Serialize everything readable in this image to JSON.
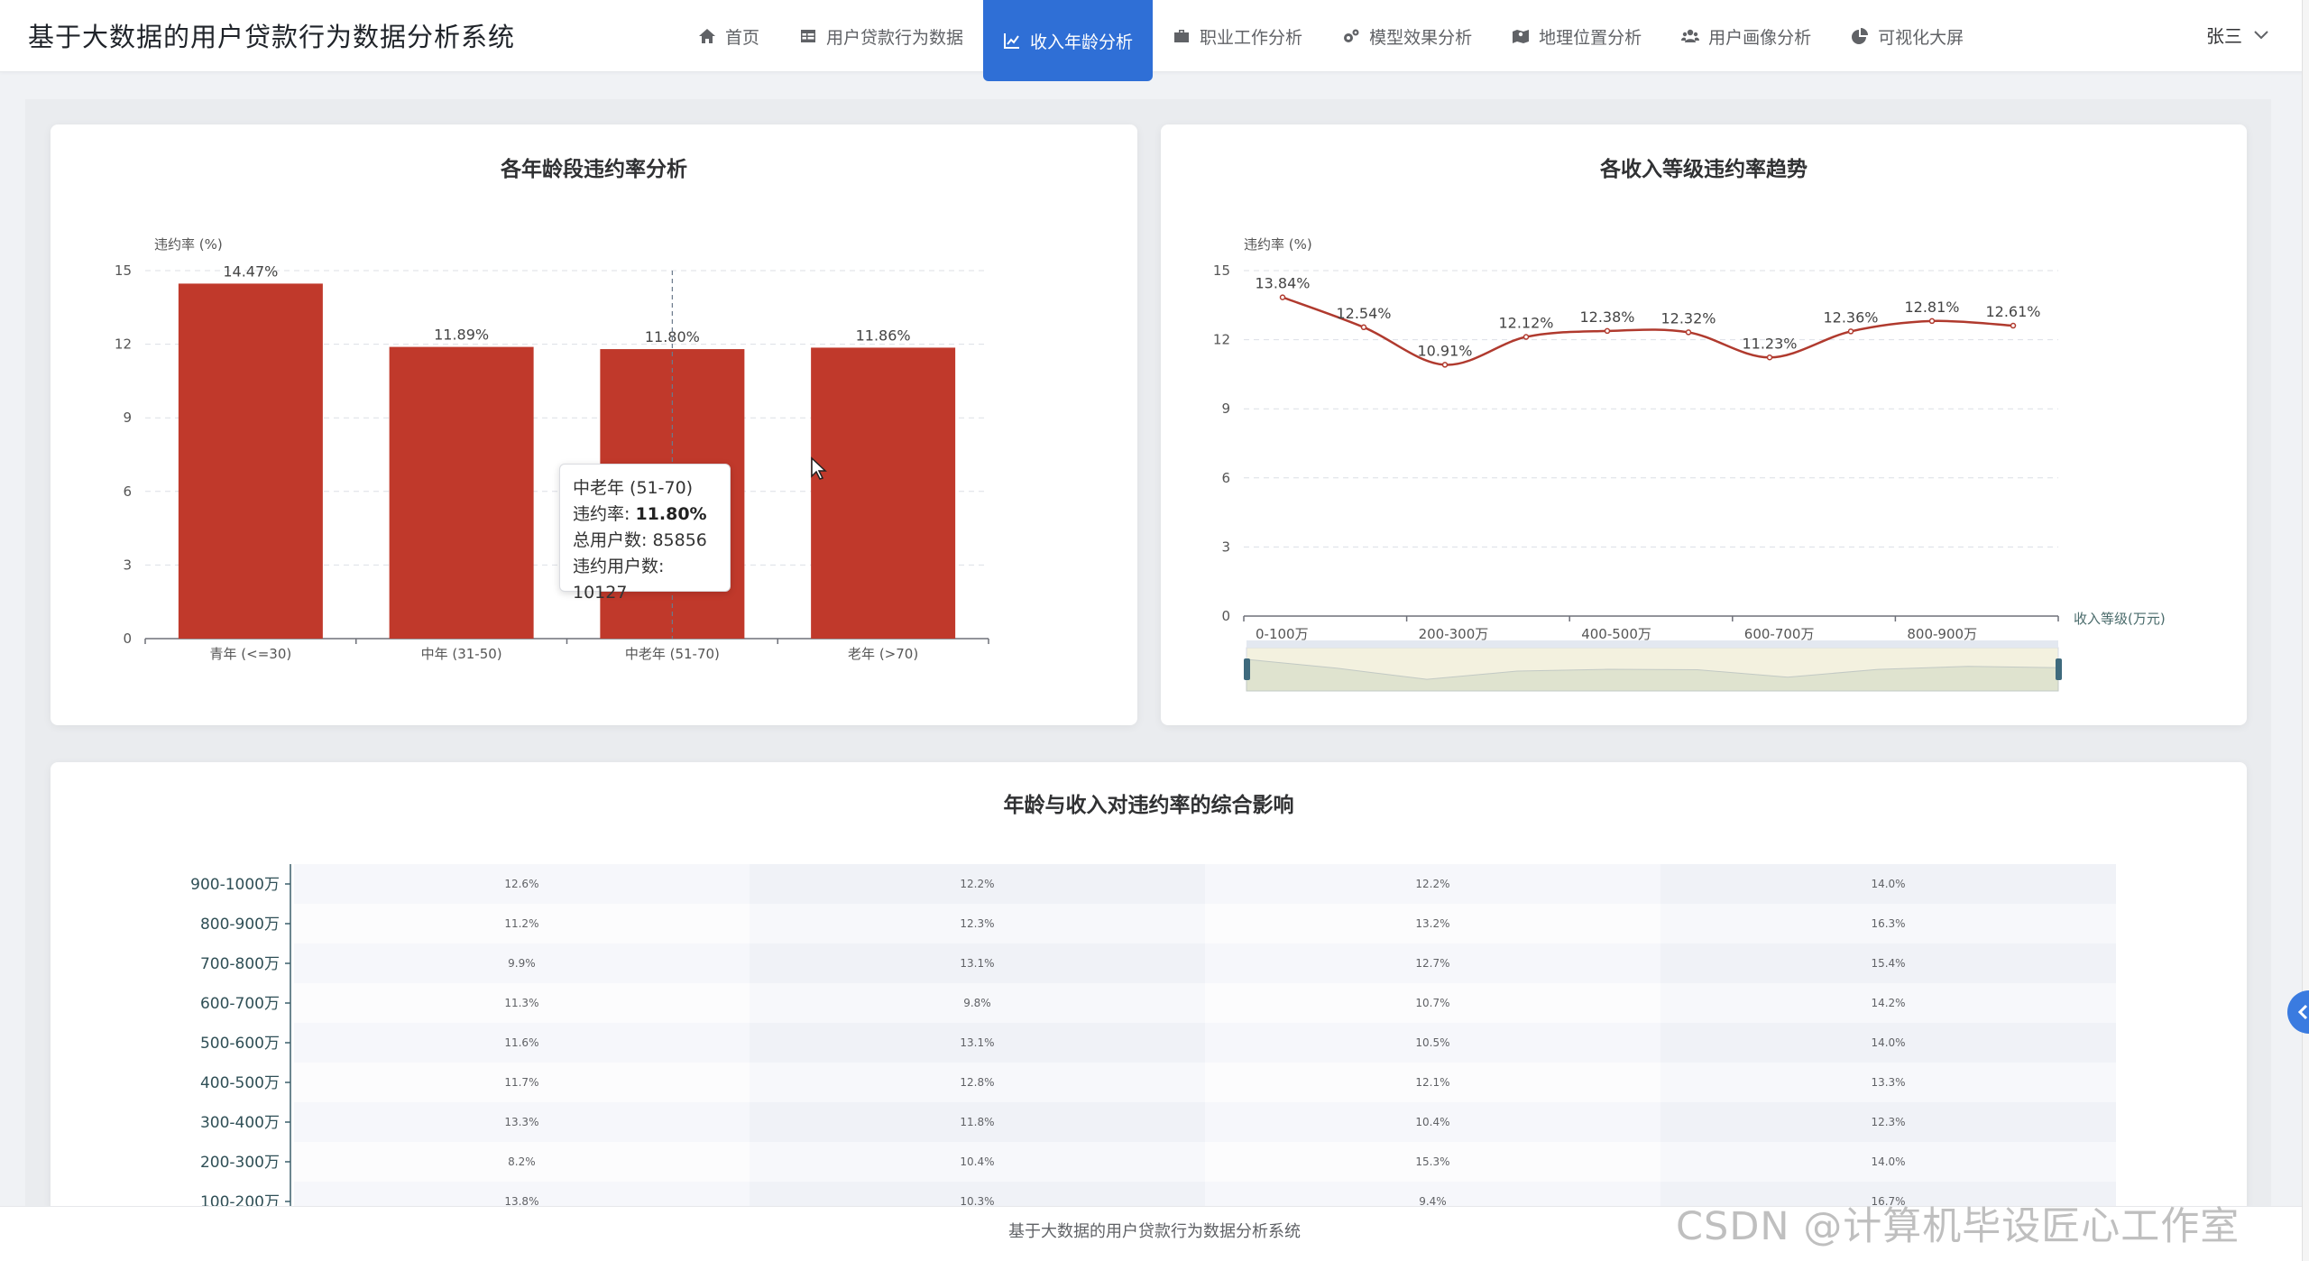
{
  "app": {
    "title": "基于大数据的用户贷款行为数据分析系统"
  },
  "nav": [
    {
      "label": "首页",
      "icon": "home-icon"
    },
    {
      "label": "用户贷款行为数据",
      "icon": "table-icon"
    },
    {
      "label": "收入年龄分析",
      "icon": "line-chart-icon",
      "active": true
    },
    {
      "label": "职业工作分析",
      "icon": "briefcase-icon"
    },
    {
      "label": "模型效果分析",
      "icon": "gears-icon"
    },
    {
      "label": "地理位置分析",
      "icon": "map-icon"
    },
    {
      "label": "用户画像分析",
      "icon": "users-icon"
    },
    {
      "label": "可视化大屏",
      "icon": "pie-chart-icon"
    }
  ],
  "user": {
    "name": "张三"
  },
  "chart_data": [
    {
      "type": "bar",
      "title": "各年龄段违约率分析",
      "ylabel": "违约率 (%)",
      "categories": [
        "青年 (<=30)",
        "中年 (31-50)",
        "中老年 (51-70)",
        "老年 (>70)"
      ],
      "values": [
        14.47,
        11.89,
        11.8,
        11.86
      ],
      "data_labels": [
        "14.47%",
        "11.89%",
        "11.80%",
        "11.86%"
      ],
      "ylim": [
        0,
        15
      ],
      "yticks": [
        "0",
        "3",
        "6",
        "9",
        "12",
        "15"
      ],
      "color": "#c0392b",
      "grid": true
    },
    {
      "type": "line",
      "title": "各收入等级违约率趋势",
      "ylabel": "违约率 (%)",
      "xlabel": "收入等级(万元)",
      "values": [
        13.84,
        12.54,
        10.91,
        12.12,
        12.38,
        12.32,
        11.23,
        12.36,
        12.81,
        12.61
      ],
      "data_labels": [
        "13.84%",
        "12.54%",
        "10.91%",
        "12.12%",
        "12.38%",
        "12.32%",
        "11.23%",
        "12.36%",
        "12.81%",
        "12.61%"
      ],
      "xtick_labels": [
        "0-100万",
        "200-300万",
        "400-500万",
        "600-700万",
        "800-900万"
      ],
      "ylim": [
        0,
        15
      ],
      "yticks": [
        "0",
        "3",
        "6",
        "9",
        "12",
        "15"
      ],
      "color": "#b03a2e",
      "grid": true,
      "datazoom": true
    },
    {
      "type": "heatmap",
      "title": "年龄与收入对违约率的综合影响",
      "rows": [
        "900-1000万",
        "800-900万",
        "700-800万",
        "600-700万",
        "500-600万",
        "400-500万",
        "300-400万",
        "200-300万",
        "100-200万"
      ],
      "cells": [
        [
          "12.6%",
          "12.2%",
          "12.2%",
          "14.0%"
        ],
        [
          "11.2%",
          "12.3%",
          "13.2%",
          "16.3%"
        ],
        [
          "9.9%",
          "13.1%",
          "12.7%",
          "15.4%"
        ],
        [
          "11.3%",
          "9.8%",
          "10.7%",
          "14.2%"
        ],
        [
          "11.6%",
          "13.1%",
          "10.5%",
          "14.0%"
        ],
        [
          "11.7%",
          "12.8%",
          "12.1%",
          "13.3%"
        ],
        [
          "13.3%",
          "11.8%",
          "10.4%",
          "12.3%"
        ],
        [
          "8.2%",
          "10.4%",
          "15.3%",
          "14.0%"
        ],
        [
          "13.8%",
          "10.3%",
          "9.4%",
          "16.7%"
        ]
      ]
    }
  ],
  "tooltip": {
    "category": "中老年 (51-70)",
    "rate_label": "违约率: ",
    "rate_value": "11.80%",
    "total_line": "总用户数: 85856",
    "default_line": "违约用户数: 10127"
  },
  "footer": {
    "text": "基于大数据的用户贷款行为数据分析系统"
  },
  "watermark": {
    "text": "CSDN @计算机毕设匠心工作室"
  }
}
